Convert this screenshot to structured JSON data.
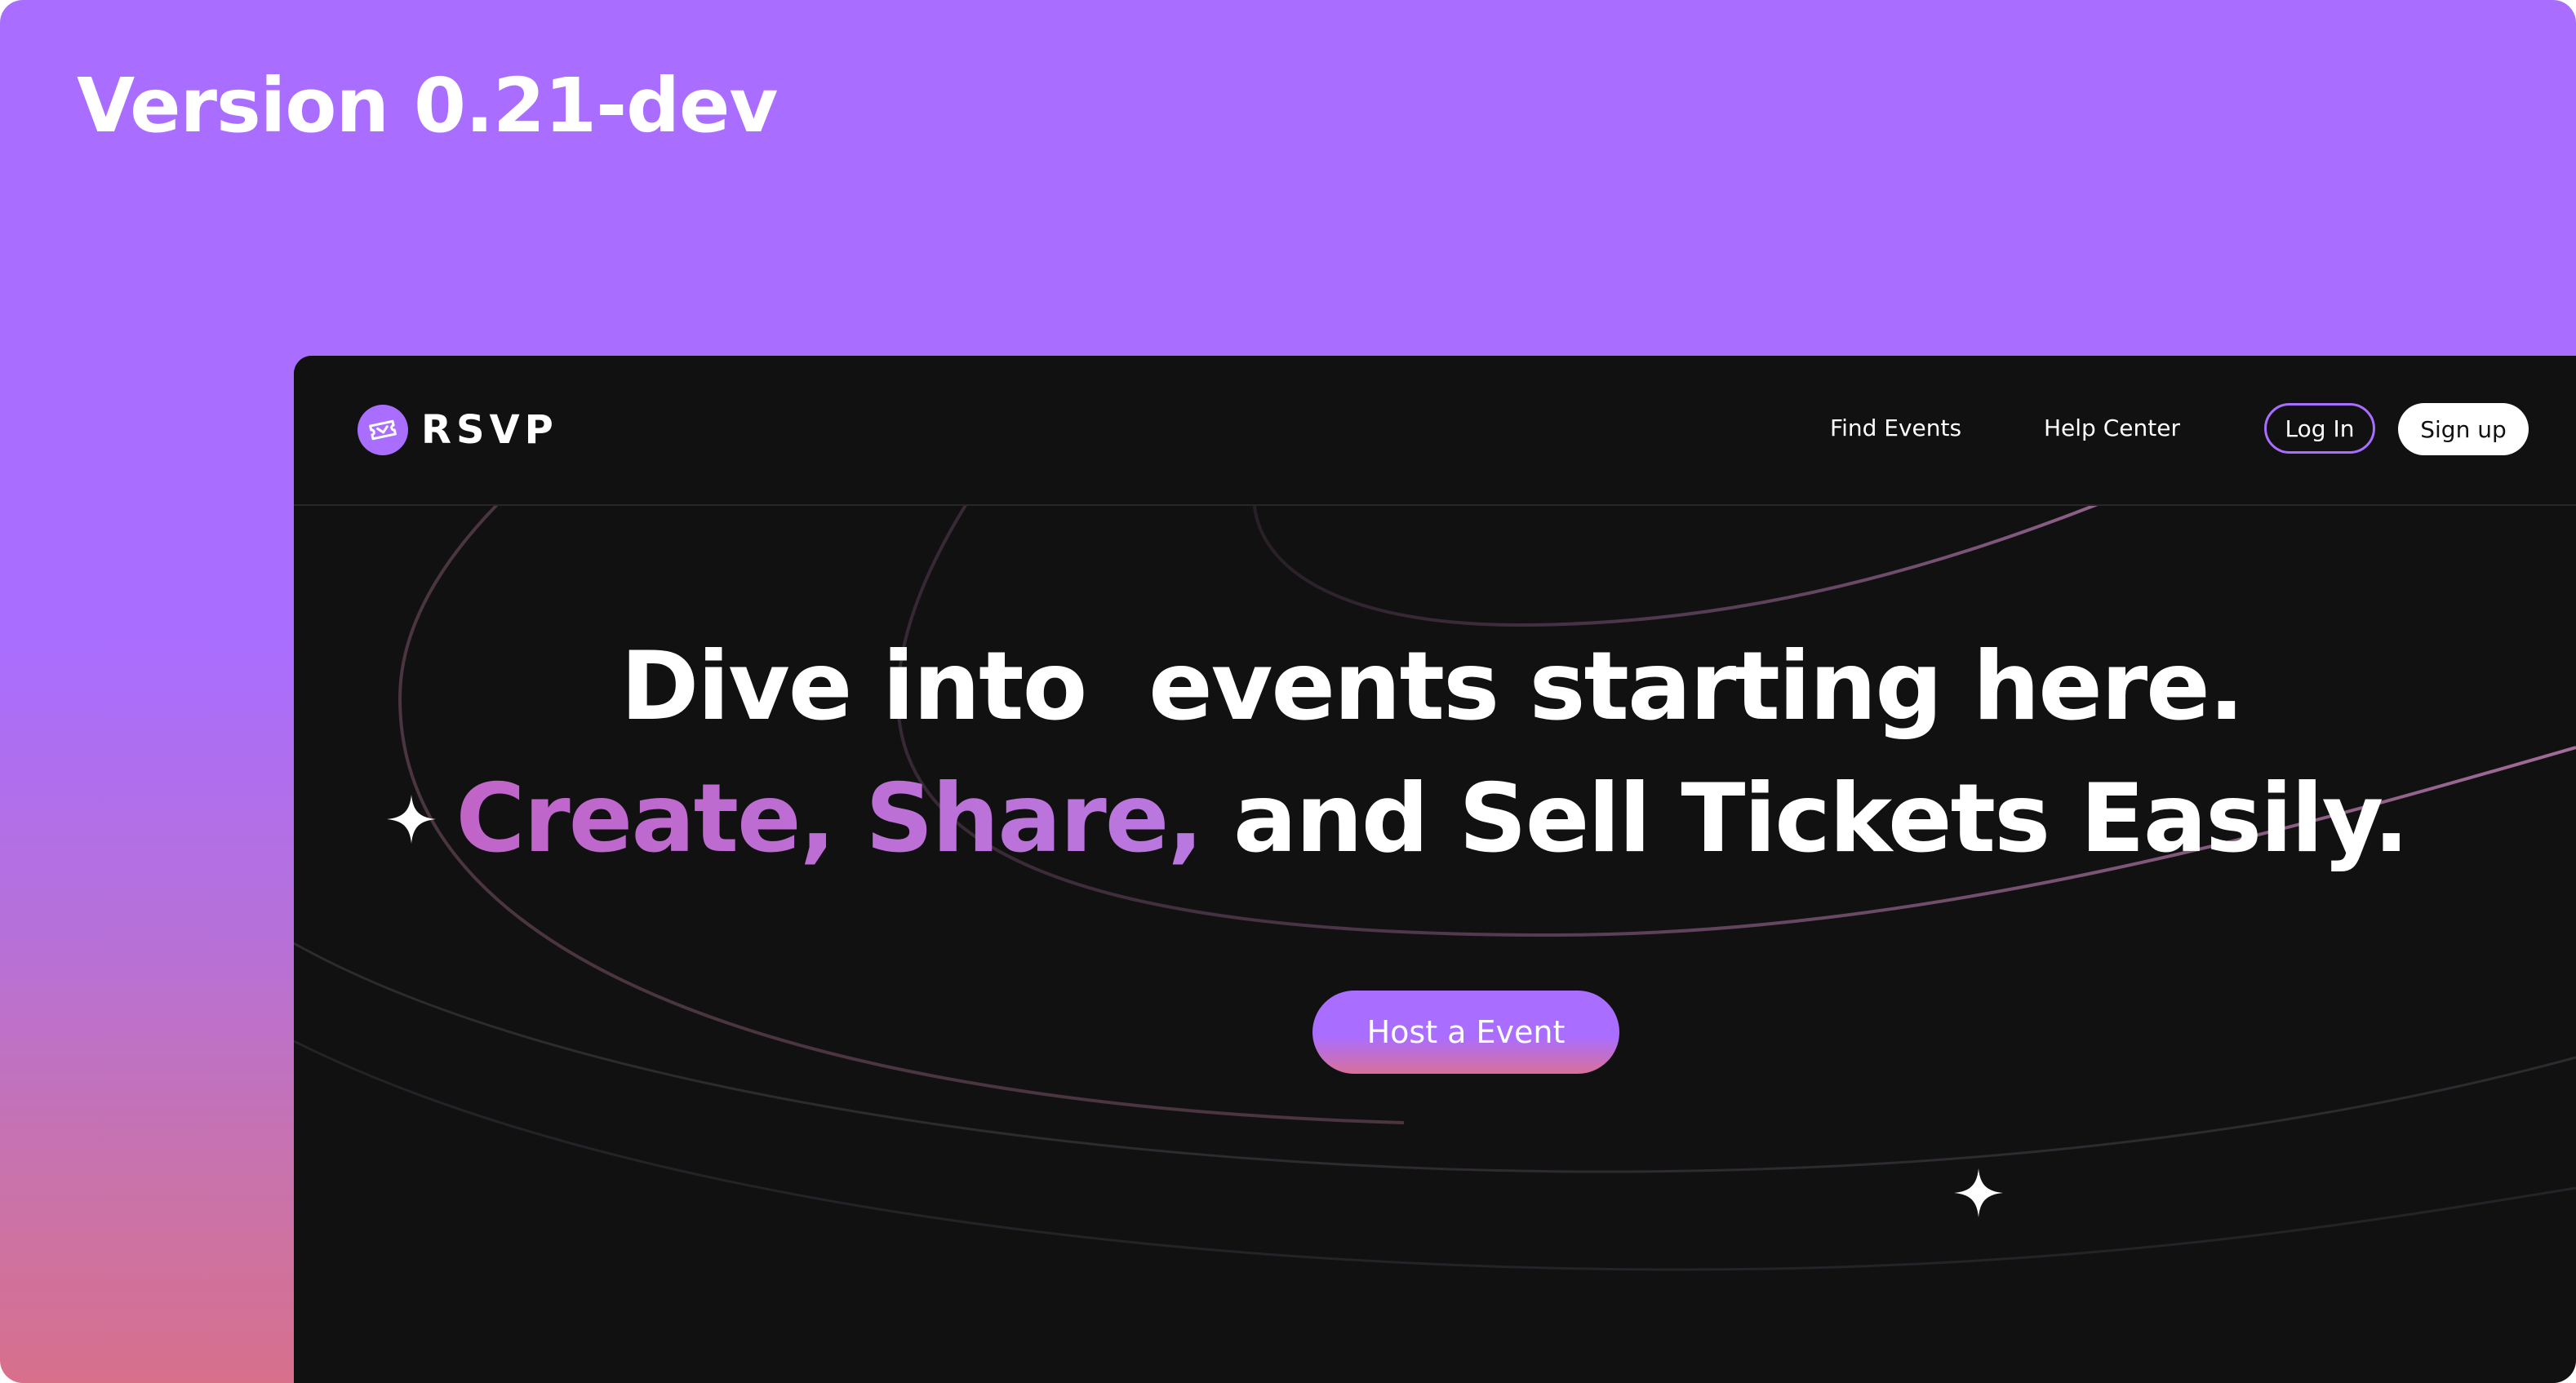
{
  "banner": {
    "version_text": "Version 0.21-dev"
  },
  "navbar": {
    "brand": "RSVP",
    "links": [
      {
        "label": "Find Events"
      },
      {
        "label": "Help Center"
      }
    ],
    "login_label": "Log In",
    "signup_label": "Sign up"
  },
  "hero": {
    "headline_line1": "Dive into  events starting here.",
    "accent_words": "Create, Share,",
    "headline_line2_rest": " and Sell Tickets Easily.",
    "cta_label": "Host a Event"
  },
  "icons": {
    "logo": "ticket-icon",
    "sparkle": "sparkle-icon"
  },
  "colors": {
    "accent": "#a96dff",
    "accent_pink": "#d8708c",
    "window_bg": "#111111",
    "text": "#ffffff"
  }
}
